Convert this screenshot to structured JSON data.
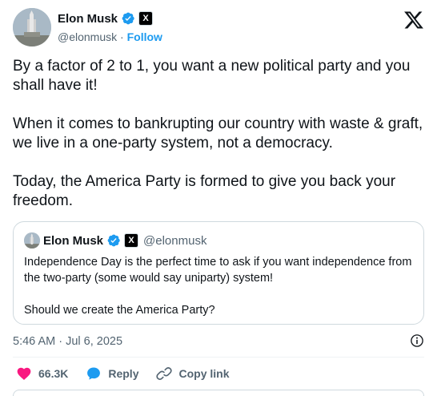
{
  "author": {
    "name": "Elon Musk",
    "handle": "@elonmusk",
    "separator": "·",
    "follow_label": "Follow"
  },
  "tweet": {
    "paragraphs": [
      "By a factor of 2 to 1, you want a new political party and you shall have it!",
      "When it comes to bankrupting our country with waste & graft, we live in a one-party system, not a democracy.",
      "Today, the America Party is formed to give you back your freedom."
    ],
    "timestamp": "5:46 AM · Jul 6, 2025"
  },
  "quote": {
    "name": "Elon Musk",
    "handle": "@elonmusk",
    "paragraphs": [
      "Independence Day is the perfect time to ask if you want independence from the two-party (some would say uniparty) system!",
      "Should we create the America Party?"
    ]
  },
  "actions": {
    "like_count": "66.3K",
    "reply_label": "Reply",
    "copy_link_label": "Copy link"
  },
  "badges": {
    "x_badge": "X"
  },
  "colors": {
    "accent": "#1d9bf0",
    "like": "#f91880",
    "text": "#0f1419",
    "muted": "#536471",
    "border": "#cfd9de"
  },
  "icons": [
    "verified-icon",
    "x-badge-icon",
    "x-logo-icon",
    "info-icon",
    "heart-icon",
    "reply-icon",
    "link-icon"
  ]
}
